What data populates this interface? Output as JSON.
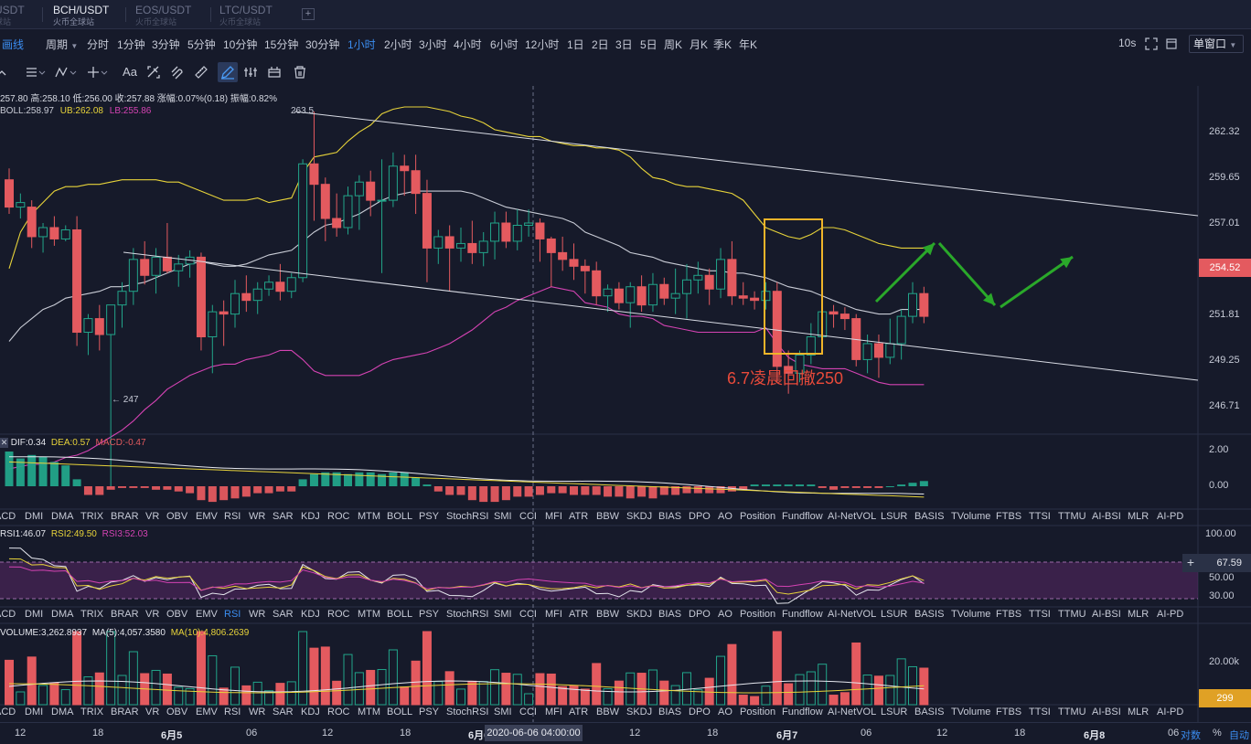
{
  "tabs": [
    {
      "name": "USDT",
      "sub": "球站"
    },
    {
      "name": "BCH/USDT",
      "sub": "火币全球站"
    },
    {
      "name": "EOS/USDT",
      "sub": "火币全球站"
    },
    {
      "name": "LTC/USDT",
      "sub": "火币全球站"
    }
  ],
  "tab_add": "+",
  "period_bar": {
    "draw_label": "画线",
    "period_label": "周期",
    "items": [
      "分时",
      "1分钟",
      "3分钟",
      "5分钟",
      "10分钟",
      "15分钟",
      "30分钟",
      "1小时",
      "2小时",
      "3小时",
      "4小时",
      "6小时",
      "12小时",
      "1日",
      "2日",
      "3日",
      "5日",
      "周K",
      "月K",
      "季K",
      "年K"
    ],
    "active": "1小时",
    "refresh": "10s",
    "window": "单窗口"
  },
  "draw_tools": [
    "Aa"
  ],
  "ohlc": "257.80 高:258.10 低:256.00 收:257.88 涨幅:0.07%(0.18) 振幅:0.82%",
  "boll": {
    "mid": "BOLL:258.97",
    "ub": "UB:262.08",
    "lb": "LB:255.86"
  },
  "price_axis": [
    "262.32",
    "259.65",
    "257.01",
    "254.52",
    "251.81",
    "249.25",
    "246.71"
  ],
  "current_price": "254.52",
  "high_marker": "263.5",
  "low_marker": "← 247",
  "annotation": "6.7凌晨回撤250",
  "macd": {
    "dif": "DIF:0.34",
    "dea": "DEA:0.57",
    "macd": "MACD:-0.47",
    "axis": [
      "2.00",
      "0.00"
    ]
  },
  "rsi": {
    "r1": "RSI1:46.07",
    "r2": "RSI2:49.50",
    "r3": "RSI3:52.03",
    "axis": [
      "100.00",
      "50.00",
      "30.00"
    ],
    "tag": "67.59",
    "plus": "+"
  },
  "volume": {
    "vol": "VOLUME:3,262.8937",
    "ma5": "MA(5):4,057.3580",
    "ma10": "MA(10):4,806.2639",
    "axis": [
      "20.00k"
    ],
    "tag": "299"
  },
  "indicators": [
    "ACD",
    "DMI",
    "DMA",
    "TRIX",
    "BRAR",
    "VR",
    "OBV",
    "EMV",
    "RSI",
    "WR",
    "SAR",
    "KDJ",
    "ROC",
    "MTM",
    "BOLL",
    "PSY",
    "StochRSI",
    "SMI",
    "CCI",
    "MFI",
    "ATR",
    "BBW",
    "SKDJ",
    "BIAS",
    "DPO",
    "AO",
    "Position",
    "Fundflow",
    "AI-NetVOL",
    "LSUR",
    "BASIS",
    "TVolume",
    "FTBS",
    "TTSI",
    "TTMU",
    "AI-BSI",
    "MLR",
    "AI-PD"
  ],
  "indicator_active_row2": "RSI",
  "time_axis": [
    "12",
    "18",
    "6月5",
    "06",
    "12",
    "18",
    "6月6",
    "12",
    "18",
    "6月7",
    "06",
    "12",
    "18",
    "6月8",
    "06"
  ],
  "crosshair_time": "2020-06-06 04:00:00",
  "footer": {
    "log": "对数",
    "pct": "%",
    "auto": "自动"
  },
  "colors": {
    "up": "#22a58a",
    "down": "#e45a5f",
    "boll_ub": "#e7d33a",
    "boll_mid": "#c9ccd6",
    "boll_lb": "#d443b3",
    "box": "#f0b429",
    "arrow": "#2aa82a",
    "accent": "#3b8df0"
  },
  "chart_data": {
    "type": "candlestick",
    "price_range": [
      246.0,
      264.0
    ],
    "candles": [
      [
        260.5,
        261.0,
        259.0,
        259.3
      ],
      [
        259.3,
        259.9,
        258.8,
        259.5
      ],
      [
        259.3,
        259.6,
        257.5,
        258.0
      ],
      [
        258.0,
        258.6,
        257.3,
        258.4
      ],
      [
        258.4,
        258.9,
        257.6,
        257.9
      ],
      [
        257.9,
        258.5,
        257.8,
        258.3
      ],
      [
        258.3,
        258.9,
        253.2,
        253.8
      ],
      [
        253.8,
        254.6,
        252.8,
        254.4
      ],
      [
        254.4,
        255.0,
        253.0,
        253.7
      ],
      [
        253.7,
        254.8,
        247.0,
        255.0
      ],
      [
        255.0,
        256.0,
        254.0,
        255.6
      ],
      [
        255.6,
        257.5,
        255.0,
        257.0
      ],
      [
        257.0,
        257.8,
        255.9,
        256.3
      ],
      [
        256.3,
        257.5,
        255.5,
        257.1
      ],
      [
        257.1,
        258.6,
        256.4,
        256.5
      ],
      [
        256.5,
        257.2,
        255.8,
        256.8
      ],
      [
        256.8,
        257.4,
        256.2,
        257.1
      ],
      [
        257.1,
        257.3,
        253.0,
        253.6
      ],
      [
        253.6,
        255.0,
        252.0,
        254.7
      ],
      [
        254.7,
        255.2,
        253.2,
        254.6
      ],
      [
        254.6,
        256.1,
        254.0,
        255.5
      ],
      [
        255.5,
        256.3,
        254.7,
        255.2
      ],
      [
        255.2,
        256.0,
        254.6,
        255.7
      ],
      [
        255.7,
        256.3,
        255.4,
        256.0
      ],
      [
        256.0,
        256.8,
        255.2,
        255.6
      ],
      [
        255.6,
        256.4,
        255.3,
        256.2
      ],
      [
        256.2,
        261.4,
        256.0,
        261.2
      ],
      [
        261.2,
        263.5,
        258.7,
        260.3
      ],
      [
        260.3,
        260.6,
        257.8,
        258.8
      ],
      [
        258.8,
        259.9,
        258.0,
        258.4
      ],
      [
        258.4,
        260.2,
        258.1,
        259.8
      ],
      [
        259.8,
        260.7,
        258.3,
        260.4
      ],
      [
        260.4,
        260.9,
        258.9,
        259.6
      ],
      [
        259.6,
        261.4,
        256.4,
        259.6
      ],
      [
        259.6,
        261.7,
        259.3,
        261.1
      ],
      [
        261.1,
        261.6,
        259.8,
        260.9
      ],
      [
        260.9,
        261.6,
        259.0,
        259.9
      ],
      [
        259.9,
        260.5,
        256.0,
        257.5
      ],
      [
        257.5,
        258.3,
        256.8,
        258.0
      ],
      [
        258.0,
        258.5,
        255.6,
        257.5
      ],
      [
        257.5,
        258.4,
        256.9,
        257.7
      ],
      [
        257.7,
        258.7,
        256.8,
        257.3
      ],
      [
        257.3,
        258.2,
        256.7,
        257.8
      ],
      [
        257.8,
        259.1,
        257.0,
        258.6
      ],
      [
        258.6,
        259.1,
        257.5,
        257.8
      ],
      [
        257.8,
        259.2,
        257.4,
        258.5
      ],
      [
        258.5,
        259.2,
        258.0,
        258.6
      ],
      [
        258.6,
        258.8,
        256.9,
        257.9
      ],
      [
        257.9,
        258.0,
        255.8,
        257.3
      ],
      [
        257.3,
        258.0,
        256.5,
        257.0
      ],
      [
        257.0,
        257.7,
        256.1,
        256.7
      ],
      [
        256.7,
        257.0,
        255.5,
        256.5
      ],
      [
        256.5,
        256.9,
        255.0,
        255.4
      ],
      [
        255.4,
        255.9,
        254.7,
        255.7
      ],
      [
        255.7,
        256.0,
        254.8,
        255.1
      ],
      [
        255.1,
        256.0,
        254.0,
        255.8
      ],
      [
        255.8,
        256.3,
        254.7,
        255.0
      ],
      [
        255.0,
        256.4,
        254.7,
        255.9
      ],
      [
        255.9,
        256.2,
        255.0,
        255.3
      ],
      [
        255.3,
        256.6,
        254.6,
        255.5
      ],
      [
        255.5,
        256.8,
        254.4,
        256.1
      ],
      [
        256.1,
        256.9,
        255.5,
        256.3
      ],
      [
        256.3,
        256.6,
        255.0,
        255.7
      ],
      [
        255.7,
        257.5,
        255.3,
        257.0
      ],
      [
        257.0,
        257.8,
        255.0,
        255.4
      ],
      [
        255.4,
        256.0,
        255.0,
        255.3
      ],
      [
        255.3,
        255.6,
        254.8,
        255.2
      ],
      [
        255.2,
        256.0,
        254.8,
        255.6
      ],
      [
        255.6,
        256.0,
        251.6,
        252.3
      ],
      [
        252.3,
        253.0,
        251.1,
        252.0
      ],
      [
        252.0,
        253.0,
        251.6,
        252.8
      ],
      [
        252.8,
        254.2,
        252.4,
        253.6
      ],
      [
        253.6,
        254.8,
        253.0,
        254.7
      ],
      [
        254.7,
        255.0,
        254.0,
        254.6
      ],
      [
        254.6,
        254.9,
        253.9,
        254.4
      ],
      [
        254.4,
        254.6,
        252.3,
        252.6
      ],
      [
        252.6,
        253.7,
        252.0,
        253.3
      ],
      [
        253.3,
        253.7,
        251.8,
        252.7
      ],
      [
        252.7,
        254.4,
        252.4,
        253.3
      ],
      [
        253.3,
        254.8,
        252.6,
        254.5
      ],
      [
        254.5,
        256.0,
        254.2,
        255.5
      ],
      [
        255.5,
        255.8,
        254.2,
        254.5
      ]
    ],
    "boll_ub": [
      256.6,
      258.2,
      259.0,
      259.5,
      260.0,
      260.2,
      260.2,
      260.3,
      260.3,
      260.4,
      260.5,
      260.5,
      260.5,
      260.5,
      260.4,
      260.4,
      260.2,
      260.0,
      259.8,
      259.6,
      259.6,
      259.6,
      259.7,
      259.5,
      259.6,
      259.7,
      260.8,
      261.5,
      261.6,
      261.7,
      262.2,
      262.6,
      262.9,
      263.4,
      263.6,
      263.7,
      263.7,
      263.7,
      263.6,
      263.5,
      263.3,
      263.2,
      263.0,
      262.7,
      262.6,
      262.5,
      262.4,
      262.4,
      262.2,
      262.1,
      262.0,
      262.0,
      261.9,
      261.9,
      261.8,
      261.5,
      261.0,
      260.6,
      260.5,
      260.3,
      260.2,
      260.2,
      260.1,
      260.0,
      259.9,
      259.6,
      259.0,
      258.4,
      258.2,
      258.0,
      257.9,
      258.1,
      258.4,
      258.4,
      258.3,
      258.1,
      257.9,
      257.7,
      257.6,
      257.5,
      257.5,
      257.5
    ],
    "boll_mid": [
      253.4,
      254.0,
      254.4,
      254.8,
      255.0,
      255.3,
      255.4,
      255.5,
      255.6,
      255.8,
      255.8,
      255.9,
      256.0,
      256.2,
      256.4,
      256.6,
      256.8,
      256.9,
      256.8,
      256.7,
      256.7,
      256.8,
      257.0,
      257.2,
      257.3,
      257.4,
      257.8,
      258.2,
      258.5,
      258.6,
      258.8,
      259.0,
      259.3,
      259.6,
      259.8,
      259.9,
      260.0,
      260.0,
      260.0,
      260.0,
      260.0,
      259.9,
      259.7,
      259.5,
      259.3,
      259.2,
      259.1,
      259.0,
      258.9,
      258.8,
      258.6,
      258.2,
      258.0,
      257.8,
      257.6,
      257.3,
      257.2,
      257.1,
      256.9,
      256.8,
      256.7,
      256.6,
      256.5,
      256.5,
      256.4,
      256.4,
      256.3,
      256.2,
      256.0,
      255.8,
      255.7,
      255.6,
      255.4,
      255.2,
      255.0,
      254.8,
      254.7,
      254.6,
      254.6,
      254.8,
      254.8,
      254.8
    ],
    "boll_lb": [
      247.8,
      247.9,
      248.0,
      248.0,
      248.1,
      248.3,
      248.4,
      248.6,
      248.9,
      249.2,
      249.5,
      249.9,
      250.4,
      250.8,
      251.3,
      251.6,
      251.9,
      252.1,
      252.3,
      252.4,
      252.4,
      252.6,
      252.7,
      252.8,
      253.0,
      253.0,
      252.6,
      252.1,
      251.9,
      251.9,
      251.9,
      251.9,
      252.1,
      252.4,
      252.6,
      252.7,
      252.8,
      252.9,
      253.1,
      253.3,
      253.6,
      253.9,
      254.3,
      254.7,
      254.9,
      255.2,
      255.4,
      255.6,
      255.8,
      255.7,
      255.6,
      255.1,
      255.0,
      254.9,
      254.6,
      254.5,
      254.5,
      254.4,
      254.1,
      254.0,
      253.9,
      253.8,
      253.8,
      253.8,
      253.8,
      253.8,
      253.8,
      254.0,
      253.3,
      252.7,
      252.4,
      252.3,
      252.2,
      252.2,
      252.2,
      252.0,
      251.8,
      251.6,
      251.5,
      251.5,
      251.5,
      251.5
    ],
    "macd_hist": [
      2.0,
      1.6,
      1.8,
      1.7,
      1.4,
      1.2,
      0.4,
      -0.5,
      -0.5,
      -0.2,
      -0.1,
      -0.1,
      -0.1,
      -0.2,
      -0.2,
      -0.3,
      -0.4,
      -0.8,
      -0.9,
      -0.8,
      -0.7,
      -0.6,
      -0.4,
      -0.4,
      -0.3,
      -0.3,
      0.4,
      0.7,
      0.8,
      0.8,
      0.7,
      0.8,
      0.8,
      0.7,
      0.8,
      0.8,
      0.5,
      0.1,
      -0.3,
      -0.5,
      -0.5,
      -0.8,
      -0.9,
      -0.9,
      -0.8,
      -0.6,
      -0.6,
      -0.5,
      -0.4,
      -0.4,
      -0.5,
      -0.5,
      -0.5,
      -0.6,
      -0.6,
      -0.7,
      -0.6,
      -0.7,
      -0.5,
      -0.5,
      -0.4,
      -0.4,
      -0.4,
      -0.4,
      -0.3,
      -0.2,
      0.1,
      0.1,
      0.1,
      0.1,
      0.1,
      0.1,
      -0.1,
      -0.2,
      -0.1,
      -0.1,
      -0.1,
      -0.1,
      0.0,
      0.1,
      0.2,
      0.3
    ],
    "rsi_range": [
      20,
      100
    ],
    "volume_max": 26000
  }
}
